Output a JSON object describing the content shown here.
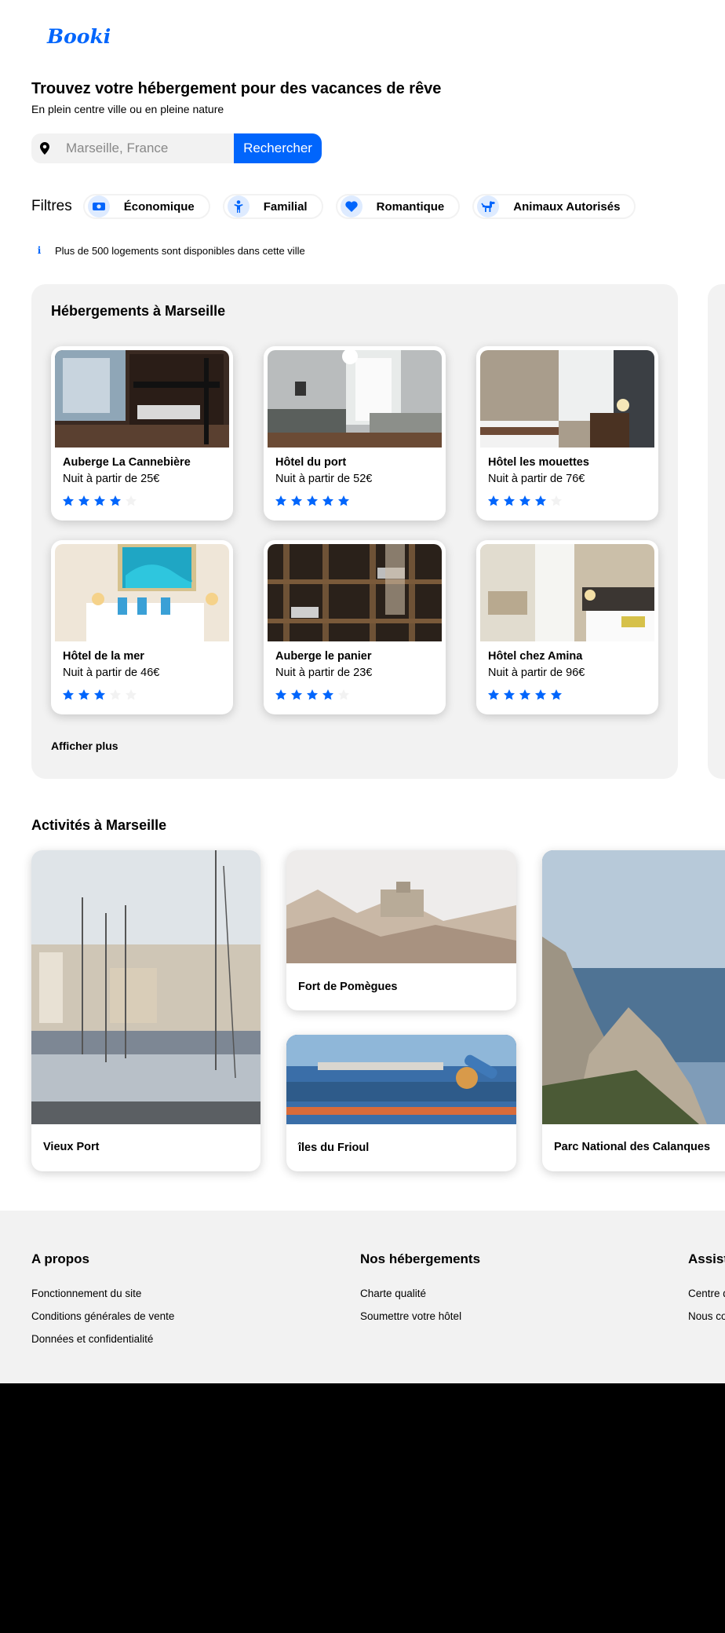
{
  "logo": "Booki",
  "hero": {
    "title": "Trouvez votre hébergement pour des vacances de rêve",
    "subtitle": "En plein centre ville ou en pleine nature"
  },
  "search": {
    "placeholder": "Marseille, France",
    "button": "Rechercher",
    "icon": "map-pin-icon"
  },
  "filters": {
    "label": "Filtres",
    "items": [
      {
        "label": "Économique",
        "icon": "money-icon"
      },
      {
        "label": "Familial",
        "icon": "child-icon"
      },
      {
        "label": "Romantique",
        "icon": "heart-icon"
      },
      {
        "label": "Animaux Autorisés",
        "icon": "dog-icon"
      }
    ]
  },
  "info": {
    "icon": "info-icon",
    "text": "Plus de 500 logements sont disponibles dans cette ville"
  },
  "accommodations": {
    "title": "Hébergements à Marseille",
    "more": "Afficher plus",
    "items": [
      {
        "name": "Auberge La Cannebière",
        "price": "Nuit à partir de 25€",
        "rating": 4
      },
      {
        "name": "Hôtel du port",
        "price": "Nuit à partir de 52€",
        "rating": 5
      },
      {
        "name": "Hôtel les mouettes",
        "price": "Nuit à partir de 76€",
        "rating": 4
      },
      {
        "name": "Hôtel de la mer",
        "price": "Nuit à partir de 46€",
        "rating": 3
      },
      {
        "name": "Auberge le panier",
        "price": "Nuit à partir de 23€",
        "rating": 4
      },
      {
        "name": "Hôtel chez Amina",
        "price": "Nuit à partir de 96€",
        "rating": 5
      }
    ]
  },
  "activities": {
    "title": "Activités à Marseille",
    "items": [
      {
        "name": "Vieux Port"
      },
      {
        "name": "Fort de Pomègues"
      },
      {
        "name": "îles du Frioul"
      },
      {
        "name": "Parc National des Calanques"
      }
    ]
  },
  "footer": {
    "columns": [
      {
        "title": "A propos",
        "links": [
          "Fonctionnement du site",
          "Conditions générales de vente",
          "Données et confidentialité"
        ]
      },
      {
        "title": "Nos hébergements",
        "links": [
          "Charte qualité",
          "Soumettre votre hôtel"
        ]
      },
      {
        "title": "Assistance",
        "links": [
          "Centre d'aide",
          "Nous contacter"
        ]
      }
    ]
  },
  "colors": {
    "accent": "#0065fc",
    "accent_light": "#deebff",
    "panel": "#f2f2f2",
    "star_off": "#f2f2f2"
  }
}
